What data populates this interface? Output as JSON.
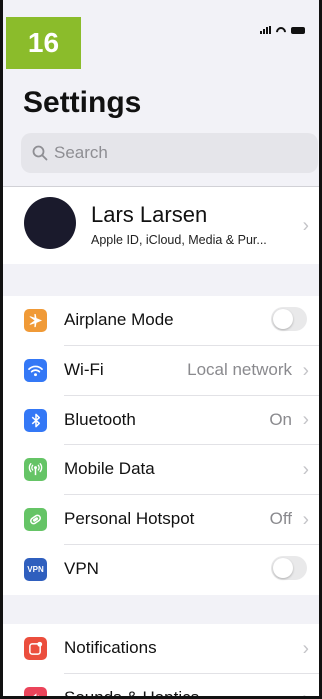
{
  "badge": {
    "number": "16",
    "color": "#8bbc2b"
  },
  "status_bar": {
    "icons": [
      "signal-icon",
      "wifi-icon",
      "battery-icon"
    ]
  },
  "header": {
    "title": "Settings"
  },
  "search": {
    "placeholder": "Search"
  },
  "profile": {
    "name": "Lars Larsen",
    "subtitle": "Apple ID, iCloud, Media & Pur..."
  },
  "groups": [
    {
      "rows": [
        {
          "label": "Airplane Mode",
          "icon": "airplane-icon",
          "icon_color": "#f09a37",
          "accessory": "toggle",
          "toggle_on": false
        },
        {
          "label": "Wi-Fi",
          "icon": "wifi-icon",
          "icon_color": "#3478f6",
          "value": "Local network",
          "accessory": "chevron"
        },
        {
          "label": "Bluetooth",
          "icon": "bluetooth-icon",
          "icon_color": "#3478f6",
          "value": "On",
          "accessory": "chevron"
        },
        {
          "label": "Mobile Data",
          "icon": "antenna-icon",
          "icon_color": "#65c466",
          "accessory": "chevron"
        },
        {
          "label": "Personal Hotspot",
          "icon": "hotspot-icon",
          "icon_color": "#65c466",
          "value": "Off",
          "accessory": "chevron"
        },
        {
          "label": "VPN",
          "icon": "vpn-icon",
          "icon_text": "VPN",
          "icon_color": "#2f5fbe",
          "accessory": "toggle",
          "toggle_on": false
        }
      ]
    },
    {
      "rows": [
        {
          "label": "Notifications",
          "icon": "notifications-icon",
          "icon_color": "#eb4e3d",
          "accessory": "chevron"
        },
        {
          "label": "Sounds & Haptics",
          "icon": "speaker-icon",
          "icon_color": "#eb445a",
          "accessory": "chevron"
        }
      ]
    }
  ]
}
